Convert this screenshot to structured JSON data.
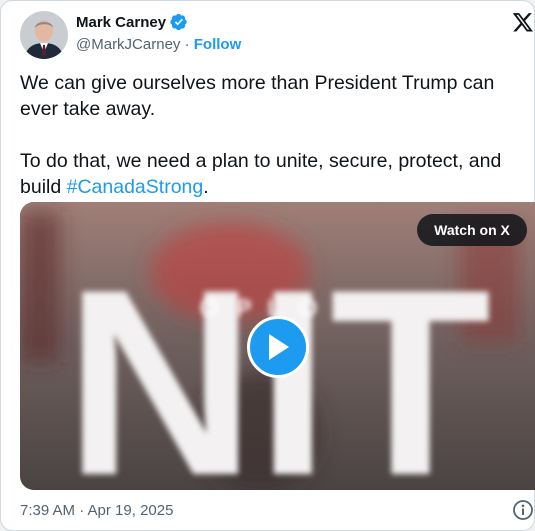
{
  "author": {
    "name": "Mark Carney",
    "handle": "@MarkJCarney",
    "separator": "·",
    "follow_label": "Follow",
    "verified": true
  },
  "tweet": {
    "line1": "We can give ourselves more than President Trump can ever take away.",
    "line2_prefix": "To do that, we need a plan to unite, secure, protect, and build ",
    "hashtag": "#CanadaStrong",
    "line2_suffix": "."
  },
  "media": {
    "watch_label": "Watch on X",
    "video_overlay_text": "NIT",
    "video_subtext": "O P L  O"
  },
  "footer": {
    "timestamp": "7:39 AM · Apr 19, 2025"
  },
  "icons": {
    "verified": "verified-badge-icon",
    "x_logo": "x-logo-icon",
    "play": "play-icon",
    "info": "info-icon"
  },
  "colors": {
    "accent": "#1d9bf0",
    "text": "#0f1419",
    "muted": "#536471"
  }
}
